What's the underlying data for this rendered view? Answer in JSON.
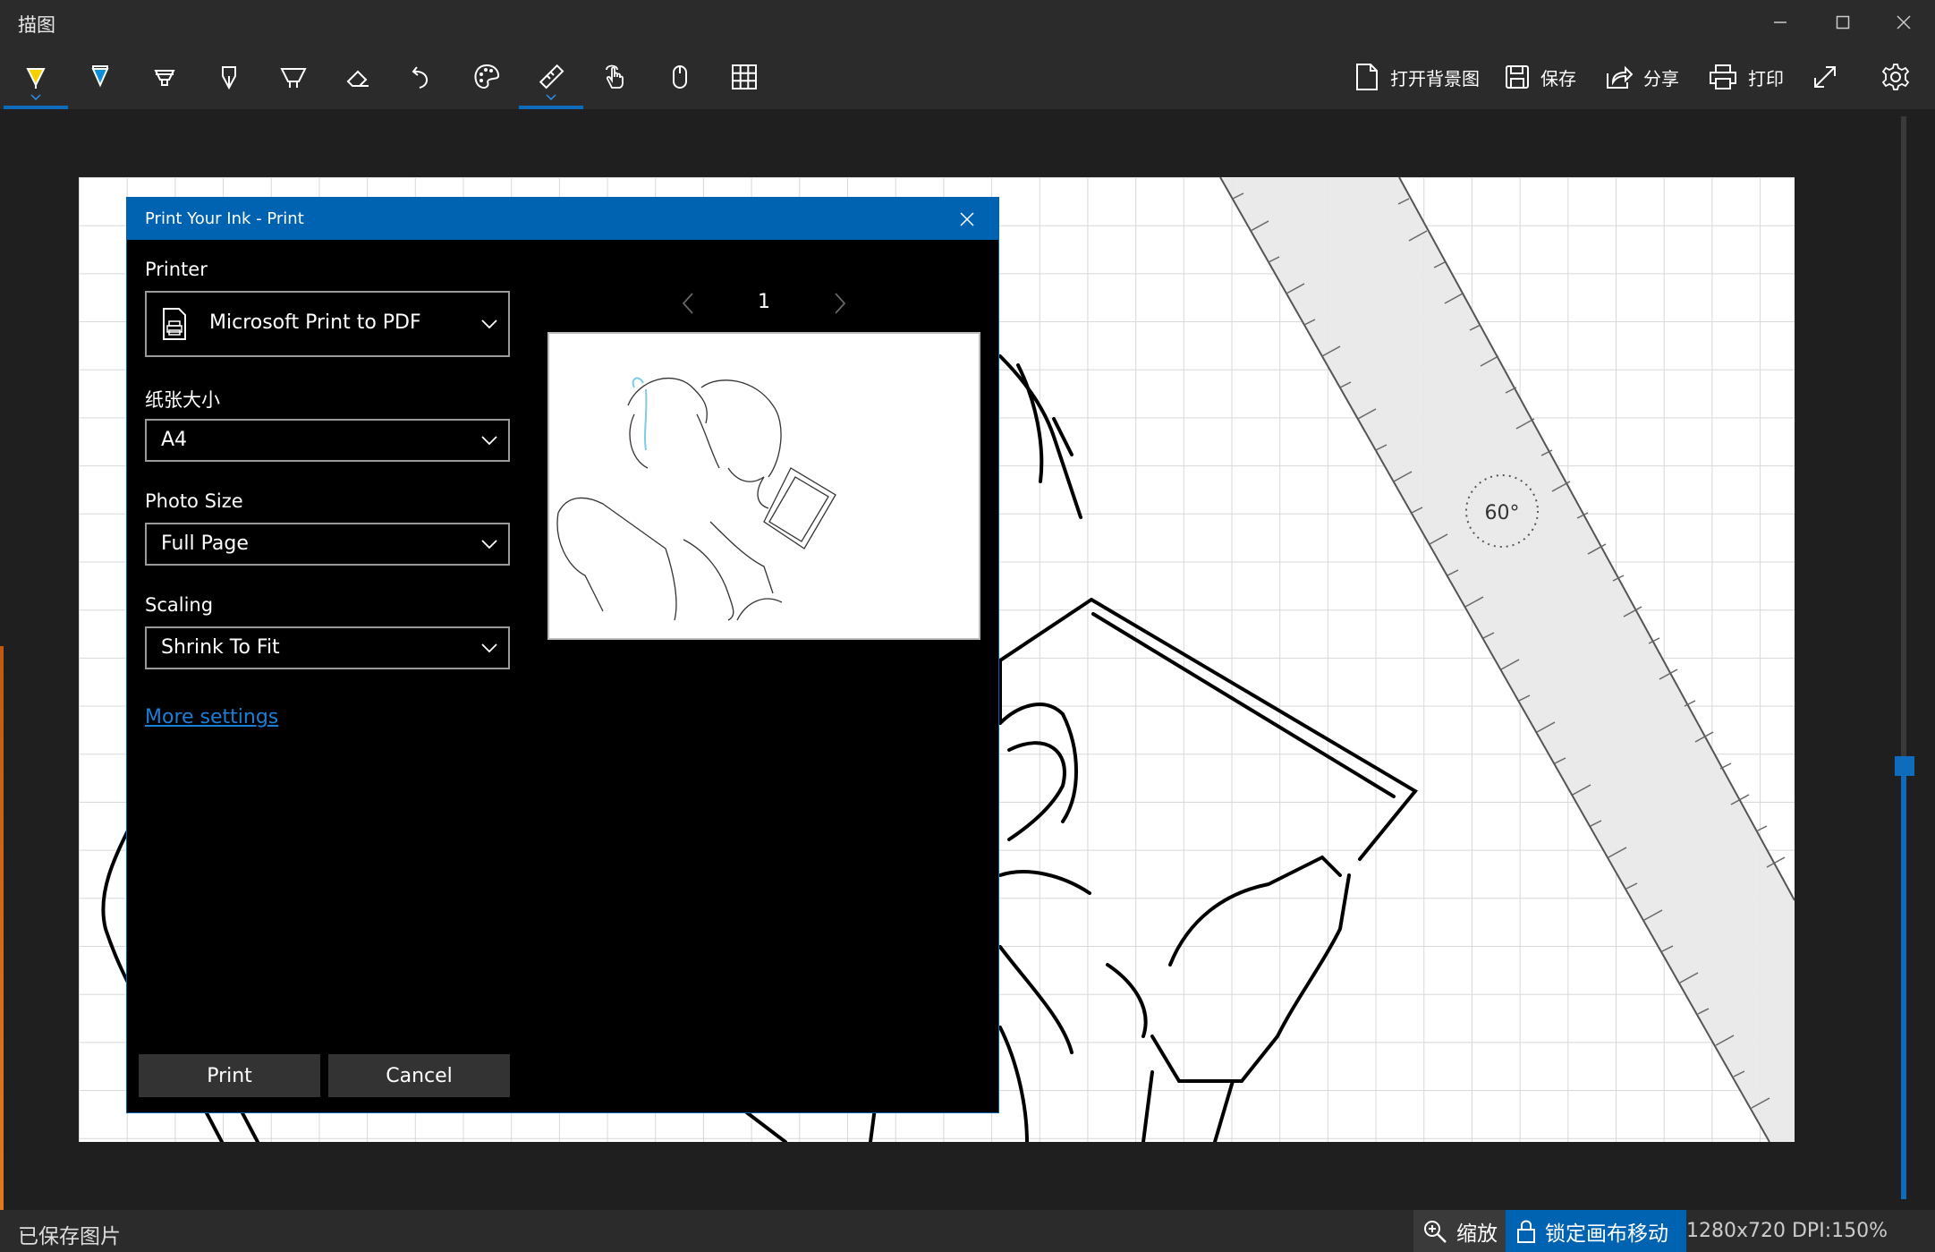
{
  "app": {
    "title": "描图"
  },
  "toolbar": {
    "tools": [
      {
        "name": "ballpoint-pen",
        "active": true
      },
      {
        "name": "pencil"
      },
      {
        "name": "highlighter"
      },
      {
        "name": "calligraphy-pen"
      },
      {
        "name": "marker"
      },
      {
        "name": "eraser"
      },
      {
        "name": "undo"
      },
      {
        "name": "color-palette"
      },
      {
        "name": "ruler",
        "active": true
      },
      {
        "name": "touch-writing"
      },
      {
        "name": "mouse"
      },
      {
        "name": "grid"
      }
    ],
    "actions": {
      "open_background": "打开背景图",
      "save": "保存",
      "share": "分享",
      "print": "打印"
    }
  },
  "ruler": {
    "angle": "60°"
  },
  "dialog": {
    "title": "Print Your Ink - Print",
    "printer_label": "Printer",
    "printer_value": "Microsoft Print to PDF",
    "paper_label": "纸张大小",
    "paper_value": "A4",
    "photo_label": "Photo Size",
    "photo_value": "Full Page",
    "scaling_label": "Scaling",
    "scaling_value": "Shrink To Fit",
    "more_settings": "More settings",
    "page_number": "1",
    "print_button": "Print",
    "cancel_button": "Cancel"
  },
  "status": {
    "saved_text": "已保存图片",
    "zoom_label": "缩放",
    "lock_label": "锁定画布移动",
    "dimensions": "1280x720 DPI:150%"
  },
  "colors": {
    "accent": "#0063b1",
    "active_tab": "#0f6cbd",
    "background": "#1f1f1f"
  }
}
